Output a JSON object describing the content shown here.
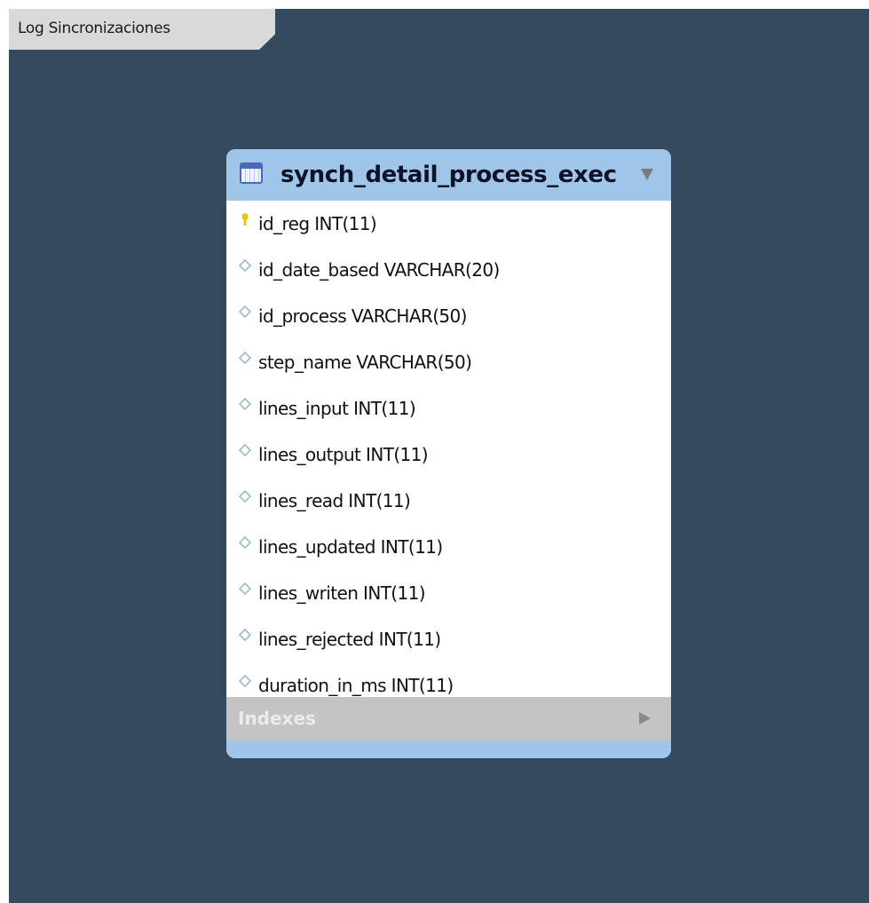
{
  "layer": {
    "name": "Log Sincronizaciones"
  },
  "table": {
    "name": "synch_detail_process_exec",
    "columns": [
      {
        "label": "id_reg INT(11)",
        "key": "primary"
      },
      {
        "label": "id_date_based VARCHAR(20)",
        "key": "none"
      },
      {
        "label": "id_process VARCHAR(50)",
        "key": "none"
      },
      {
        "label": "step_name VARCHAR(50)",
        "key": "none"
      },
      {
        "label": "lines_input INT(11)",
        "key": "none"
      },
      {
        "label": "lines_output INT(11)",
        "key": "none"
      },
      {
        "label": "lines_read INT(11)",
        "key": "none"
      },
      {
        "label": "lines_updated INT(11)",
        "key": "none"
      },
      {
        "label": "lines_writen INT(11)",
        "key": "none"
      },
      {
        "label": "lines_rejected INT(11)",
        "key": "none"
      },
      {
        "label": "duration_in_ms INT(11)",
        "key": "none"
      }
    ],
    "indexes_label": "Indexes"
  },
  "colors": {
    "canvas": "#34495e",
    "table_header": "#9fc5e8",
    "primary_key_icon": "#f2c200",
    "column_icon": "#7fb3c4",
    "indexes_bar": "#c4c4c4"
  },
  "icons": {
    "table": "table-icon",
    "primary_key": "key-icon",
    "column": "diamond-icon",
    "collapse": "triangle-down-icon",
    "expand": "triangle-right-icon"
  }
}
